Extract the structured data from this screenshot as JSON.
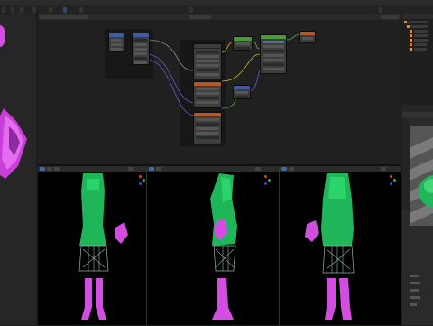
{
  "window": {
    "title": ""
  },
  "menu": {
    "items": [
      "",
      "",
      "",
      "",
      "",
      "",
      "",
      "",
      ""
    ]
  },
  "colors": {
    "accent": "#3a6aa8",
    "dress_green": "#1fb65a",
    "boot_pink": "#e055e6",
    "node_input": "#b5582a",
    "node_shader": "#4a9a3c",
    "node_vector": "#3f5aa8",
    "link_yellow": "#c9b52a",
    "link_purple": "#6a5acd",
    "link_gray": "#8a8a8a",
    "link_green": "#5aaa4a"
  },
  "icons": [
    "outliner-scene-icon",
    "collection-icon",
    "object-icon",
    "camera-icon",
    "light-icon",
    "render-sphere-icon"
  ],
  "nodes": [
    {
      "id": "texcoord",
      "color": "node_vector"
    },
    {
      "id": "mapping",
      "color": "node_vector"
    },
    {
      "id": "image-texture-1",
      "color": "node_input"
    },
    {
      "id": "image-texture-2",
      "color": "node_input"
    },
    {
      "id": "image-texture-3",
      "color": "node_input"
    },
    {
      "id": "normal-map",
      "color": "node_vector"
    },
    {
      "id": "mix-shader",
      "color": "node_shader"
    },
    {
      "id": "principled-bsdf",
      "color": "node_shader"
    },
    {
      "id": "material-output",
      "color": "node_input"
    }
  ],
  "viewports": [
    {
      "name": "front-view",
      "subject": "figure-front"
    },
    {
      "name": "side-view",
      "subject": "figure-side"
    },
    {
      "name": "back-view",
      "subject": "figure-back"
    }
  ]
}
